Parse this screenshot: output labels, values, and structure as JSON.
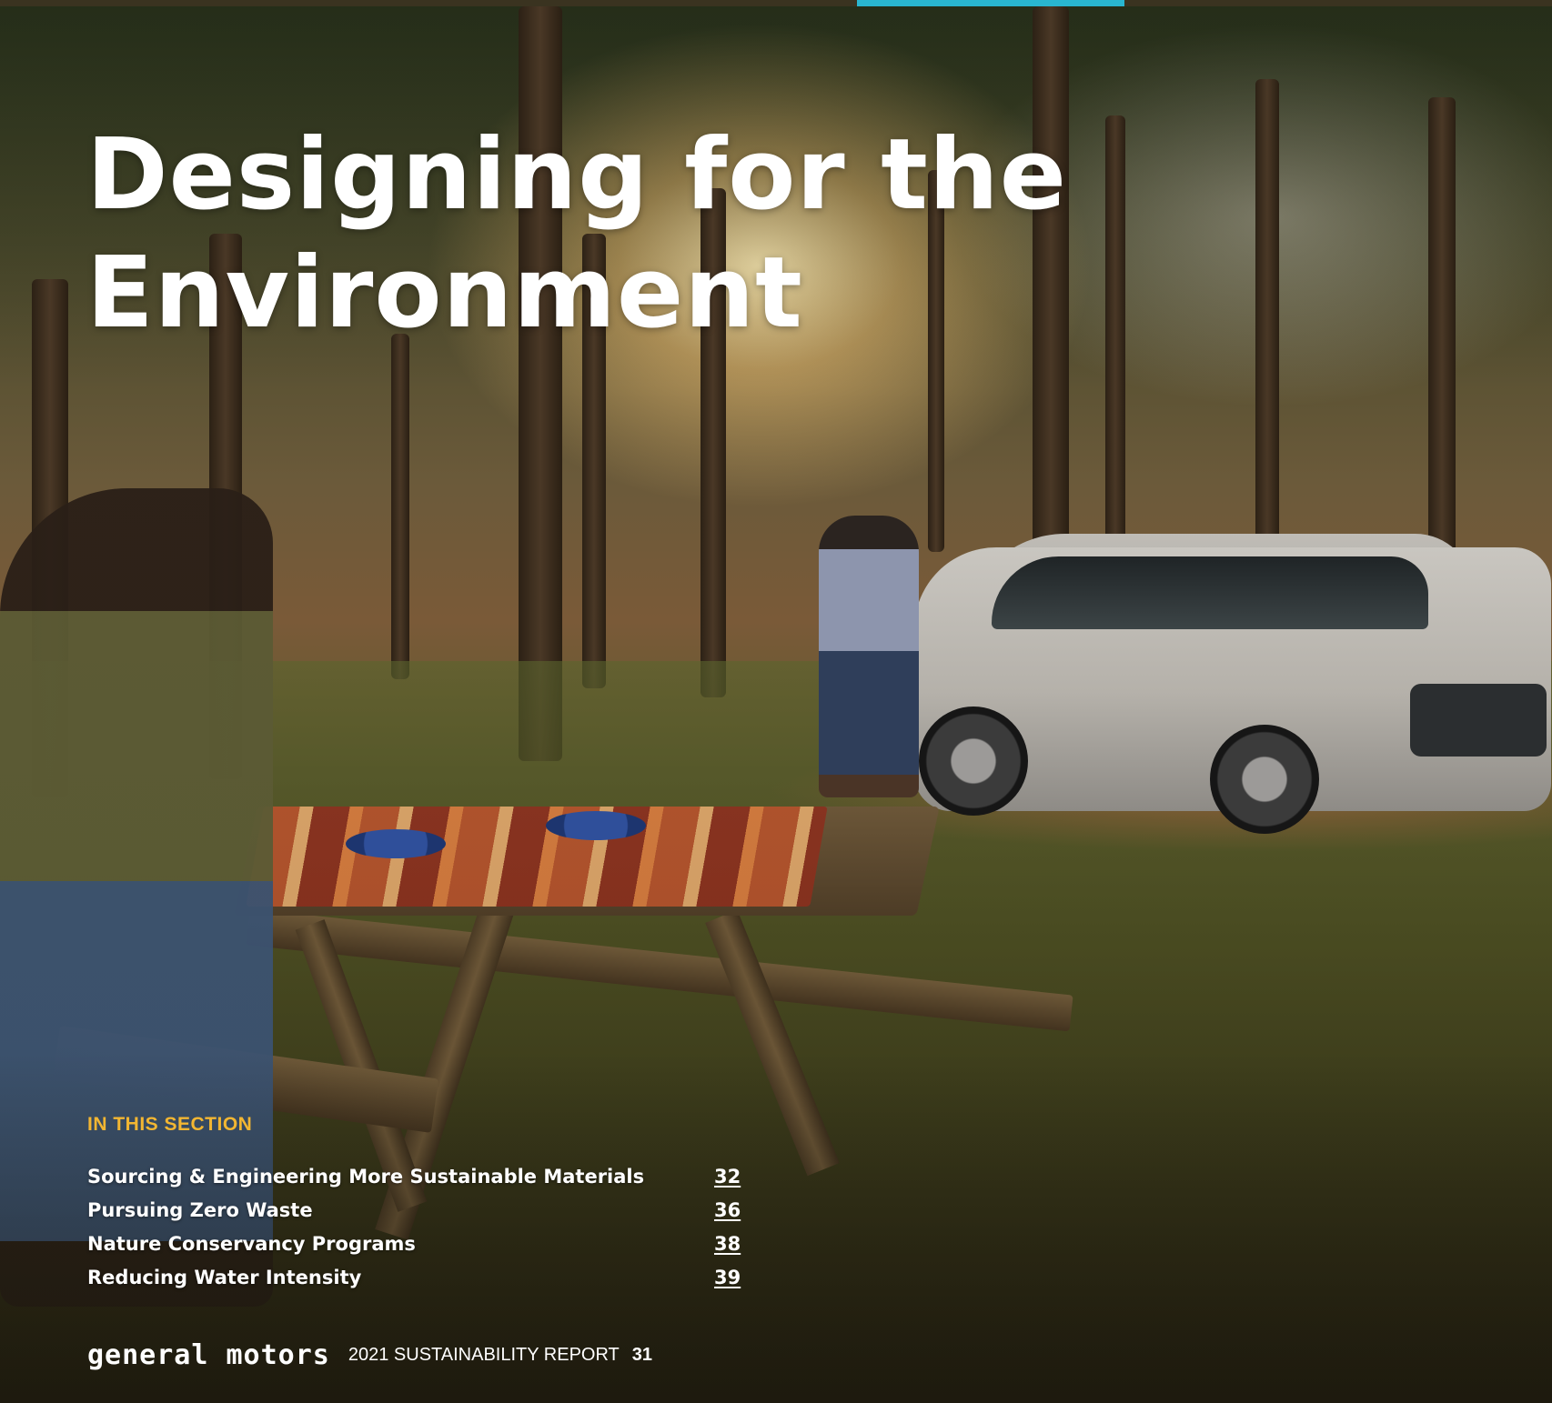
{
  "title": {
    "line1": "Designing for the",
    "line2": "Environment"
  },
  "section": {
    "heading": "IN THIS SECTION",
    "items": [
      {
        "label": "Sourcing & Engineering More Sustainable Materials",
        "page": "32"
      },
      {
        "label": "Pursuing Zero Waste",
        "page": "36"
      },
      {
        "label": "Nature Conservancy Programs",
        "page": "38"
      },
      {
        "label": "Reducing Water Intensity",
        "page": "39"
      }
    ]
  },
  "footer": {
    "brand": "general motors",
    "report": "2021 SUSTAINABILITY REPORT",
    "page_number": "31"
  },
  "colors": {
    "accent_bar": "#29b6d0",
    "section_heading": "#f2b632",
    "text": "#ffffff"
  }
}
